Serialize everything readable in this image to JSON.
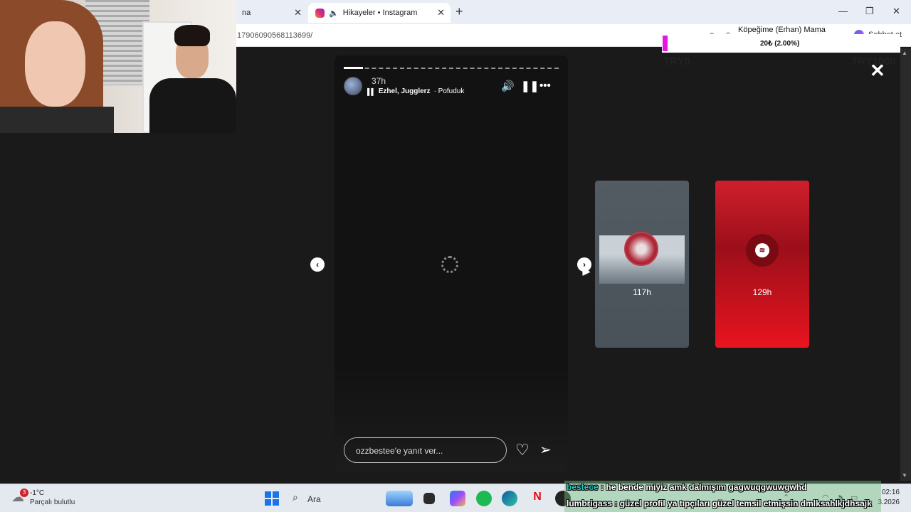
{
  "browser": {
    "inactive_tab_label": "na",
    "active_tab_label": "Hikayeler • Instagram",
    "tab_close": "✕",
    "new_tab": "+",
    "url": "17906090568113699/",
    "chat_button": "Sohbet et",
    "window": {
      "minimize": "—",
      "maximize": "❐",
      "close": "✕"
    }
  },
  "story": {
    "time": "37h",
    "music_artist": "Ezhel, Jugglerz",
    "music_separator": " · ",
    "music_title": "Pofuduk",
    "reply_placeholder": "ozzbestee'e yanıt ver...",
    "progress_fraction": 0.09,
    "prev_icon": "‹",
    "next_icon": "›"
  },
  "previews": [
    {
      "time": "117h"
    },
    {
      "time": "129h"
    }
  ],
  "close_icon": "✕",
  "donation": {
    "label": "Köpeğime (Erhan) Mama",
    "amount": "20₺ (2.00%)",
    "progress_percent": 2.0,
    "goal_min": "TRY0",
    "goal_max": "TRY1000",
    "bar_color": "#e614e6"
  },
  "taskbar": {
    "weather_badge": "3",
    "temperature": "-1°C",
    "weather_desc": "Parçalı bulutlu",
    "search_label": "Ara",
    "clock": "02:16",
    "date": "3.2026"
  },
  "chat": [
    {
      "user": "bestece",
      "message": ": he bende miyiz amk dalmışım gagwuqgwuwgwhd"
    },
    {
      "user": "lumbrigass",
      "message": ": güzel profil ya tıpçıları güzel temsil etmişsin dmlksahlkjdhsajk"
    }
  ],
  "icons": {
    "instagram": "instagram-icon",
    "audio": "speaker-icon",
    "mute": "volume-icon",
    "pause": "pause-icon",
    "more": "more-icon",
    "heart": "heart-icon",
    "send": "send-icon",
    "spotify": "spotify-icon"
  }
}
